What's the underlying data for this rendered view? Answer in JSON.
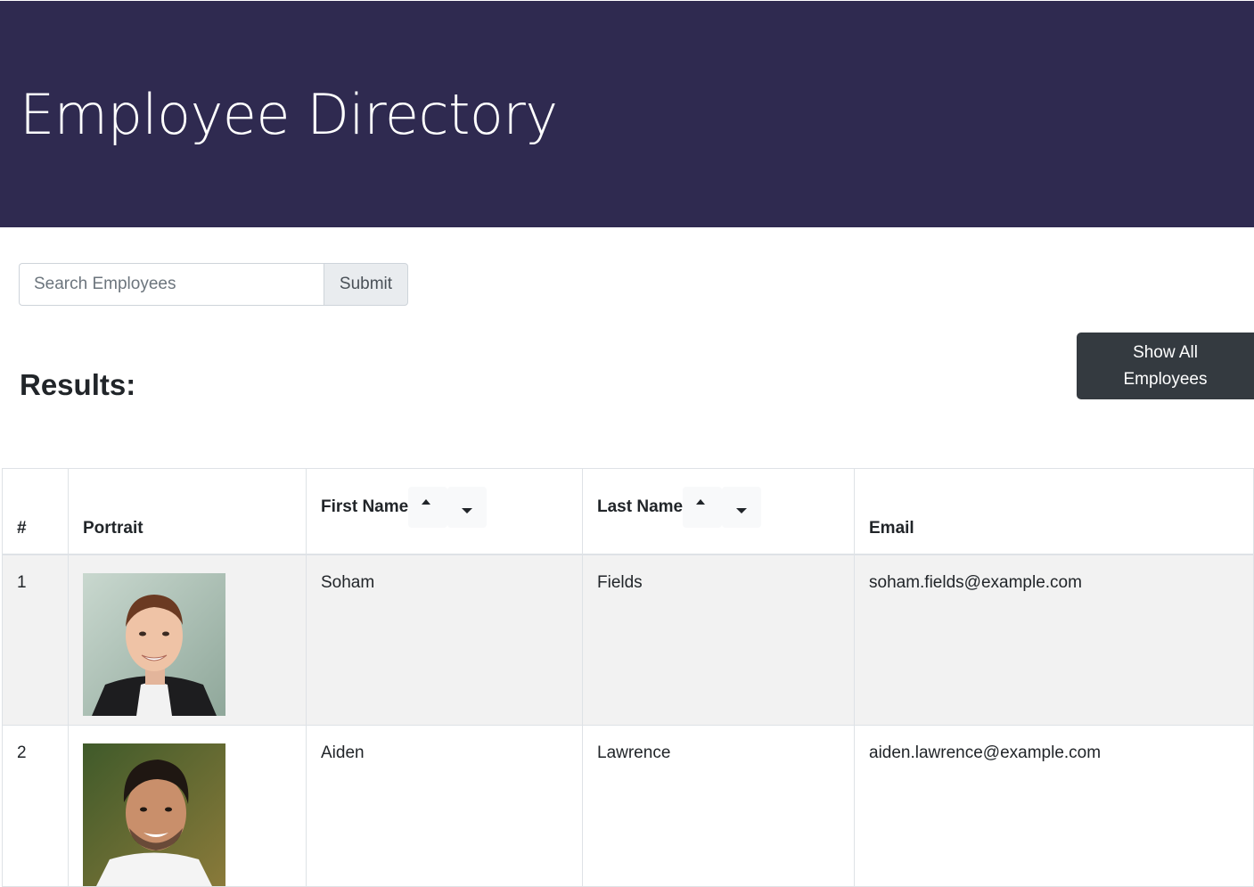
{
  "header": {
    "title": "Employee Directory"
  },
  "search": {
    "placeholder": "Search Employees",
    "value": "",
    "submit_label": "Submit"
  },
  "results": {
    "heading": "Results:",
    "show_all_label": "Show All Employees"
  },
  "table": {
    "headers": {
      "index": "#",
      "portrait": "Portrait",
      "first_name": "First Name",
      "last_name": "Last Name",
      "email": "Email"
    },
    "rows": [
      {
        "index": "1",
        "first_name": "Soham",
        "last_name": "Fields",
        "email": "soham.fields@example.com"
      },
      {
        "index": "2",
        "first_name": "Aiden",
        "last_name": "Lawrence",
        "email": "aiden.lawrence@example.com"
      }
    ]
  },
  "colors": {
    "header_bg": "#2f2a50",
    "button_dark": "#343a40",
    "stripe": "#f2f2f2"
  },
  "icons": [
    "caret-up-icon",
    "caret-down-icon"
  ]
}
